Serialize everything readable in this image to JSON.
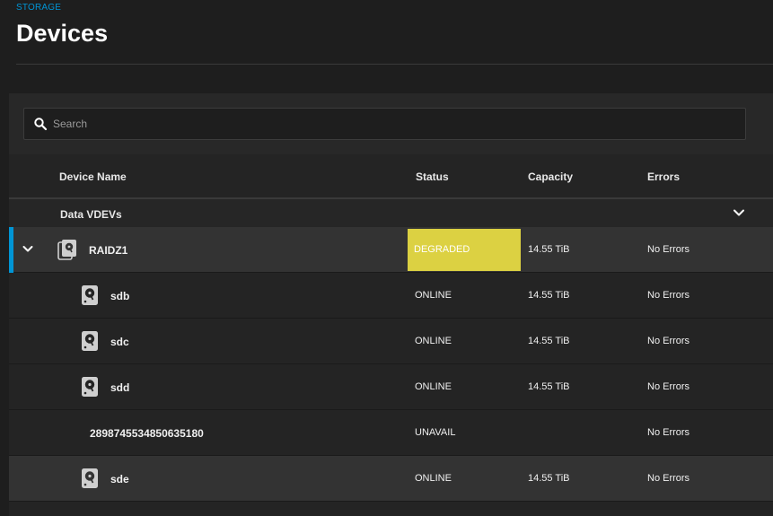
{
  "header": {
    "breadcrumb": "STORAGE",
    "title": "Devices"
  },
  "search": {
    "placeholder": "Search",
    "value": ""
  },
  "table": {
    "columns": [
      "Device Name",
      "Status",
      "Capacity",
      "Errors"
    ],
    "group": {
      "label": "Data VDEVs",
      "expanded": true
    },
    "vdev": {
      "name": "RAIDZ1",
      "status": "DEGRADED",
      "capacity": "14.55 TiB",
      "errors": "No Errors",
      "expanded": true,
      "selected": true
    },
    "disks": [
      {
        "name": "sdb",
        "status": "ONLINE",
        "capacity": "14.55 TiB",
        "errors": "No Errors",
        "icon": "hard-disk-icon"
      },
      {
        "name": "sdc",
        "status": "ONLINE",
        "capacity": "14.55 TiB",
        "errors": "No Errors",
        "icon": "hard-disk-icon"
      },
      {
        "name": "sdd",
        "status": "ONLINE",
        "capacity": "14.55 TiB",
        "errors": "No Errors",
        "icon": "hard-disk-icon"
      },
      {
        "name": "2898745534850635180",
        "status": "UNAVAIL",
        "capacity": "",
        "errors": "No Errors",
        "icon": ""
      },
      {
        "name": "sde",
        "status": "ONLINE",
        "capacity": "14.55 TiB",
        "errors": "No Errors",
        "icon": "hard-disk-icon"
      }
    ]
  },
  "colors": {
    "accent": "#0095d5",
    "degraded": "#dcd142",
    "background": "#1e1e1e",
    "row_highlight": "#333333"
  }
}
